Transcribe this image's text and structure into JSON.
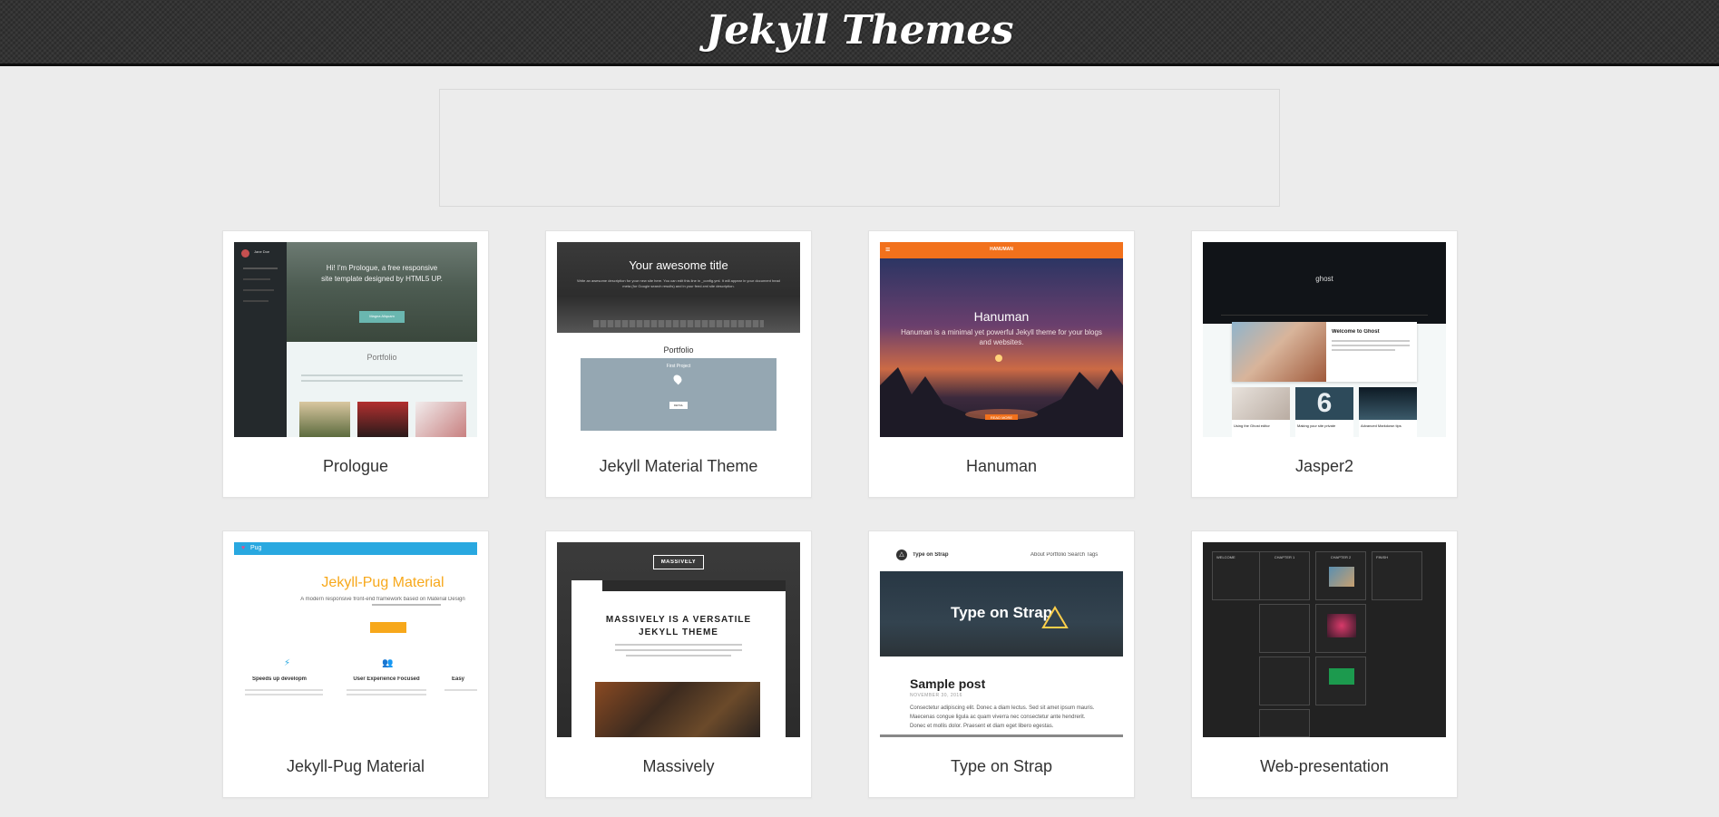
{
  "header": {
    "title": "Jekyll Themes"
  },
  "themes": [
    {
      "name": "Prologue",
      "preview": {
        "sidebar_title": "Jane Doe",
        "hero_line1": "Hi! I'm Prologue, a free responsive",
        "hero_line2": "site template designed by HTML5 UP.",
        "hero_button": "Magna Aliquam",
        "section_title": "Portfolio"
      }
    },
    {
      "name": "Jekyll Material Theme",
      "preview": {
        "hero_title": "Your awesome title",
        "hero_text": "Write an awesome description for your new site here. You can edit this line in _config.yml. It will appear in your document head meta (for Google search results) and in your feed.xml site description.",
        "section_title": "Portfolio",
        "box_title": "First Project",
        "box_button": "DETAIL"
      }
    },
    {
      "name": "Hanuman",
      "preview": {
        "brand": "HANUMAN",
        "hero_title": "Hanuman",
        "hero_text": "Hanuman is a minimal yet powerful Jekyll theme for your blogs and websites.",
        "hero_button": "READ MORE"
      }
    },
    {
      "name": "Jasper2",
      "preview": {
        "brand": "ghost",
        "post_title": "Welcome to Ghost",
        "card1": "Using the Ghost editor",
        "card2": "Making your site private",
        "card3": "Advanced Markdown tips"
      }
    },
    {
      "name": "Jekyll-Pug Material",
      "preview": {
        "brand": "Pug",
        "hero_title": "Jekyll-Pug Material",
        "hero_subtitle": "A modern responsive front-end framework based on Material Design",
        "feature1": "Speeds up development",
        "feature2": "User Experience Focused",
        "feature3": "Easy"
      }
    },
    {
      "name": "Massively",
      "preview": {
        "logo": "MASSIVELY",
        "headline1": "MASSIVELY IS A VERSATILE",
        "headline2": "JEKYLL THEME"
      }
    },
    {
      "name": "Type on Strap",
      "preview": {
        "brand": "Type on Strap",
        "nav": "About  Portfolio  Search  Tags",
        "hero_title": "Type on Strap",
        "post_title": "Sample post",
        "post_date": "NOVEMBER 30, 2016",
        "post_text": "Consectetur adipiscing elit. Donec a diam lectus. Sed sit amet ipsum mauris. Maecenas congue ligula ac quam viverra nec consectetur ante hendrerit. Donec et mollis dolor. Praesent et diam eget libero egestas."
      }
    },
    {
      "name": "Web-presentation",
      "preview": {
        "slide1": "WELCOME",
        "slide2": "CHAPTER 1",
        "slide3": "CHAPTER 2",
        "slide4": "FINISH"
      }
    }
  ],
  "colors": {
    "header_bg": "#333333",
    "page_bg": "#ececec",
    "card_bg": "#ffffff",
    "hanuman_orange": "#f2711c",
    "pug_blue": "#29a8e0",
    "pug_orange": "#f7a81b"
  }
}
